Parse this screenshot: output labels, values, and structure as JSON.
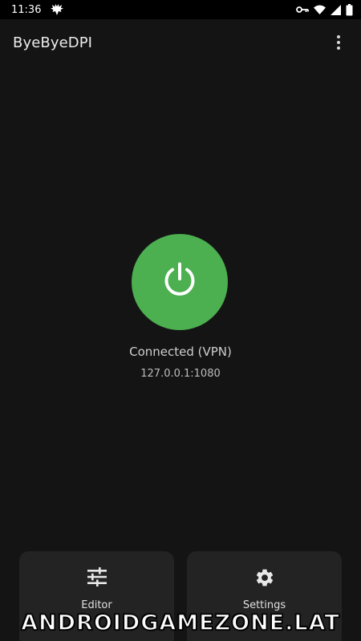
{
  "status_bar": {
    "time": "11:36",
    "icons": [
      "bird-icon",
      "vpn-key-icon",
      "wifi-icon",
      "signal-icon",
      "battery-icon"
    ]
  },
  "app_bar": {
    "title": "ByeByeDPI",
    "menu_icon": "more-vert-icon"
  },
  "main": {
    "power_icon": "power-icon",
    "power_color": "#4caf50",
    "status": "Connected (VPN)",
    "address": "127.0.0.1:1080"
  },
  "cards": {
    "editor": {
      "label": "Editor",
      "icon": "tune-icon"
    },
    "settings": {
      "label": "Settings",
      "icon": "gear-icon"
    }
  },
  "watermark": {
    "text": "ANDROIDGAMEZONE.LAT"
  }
}
